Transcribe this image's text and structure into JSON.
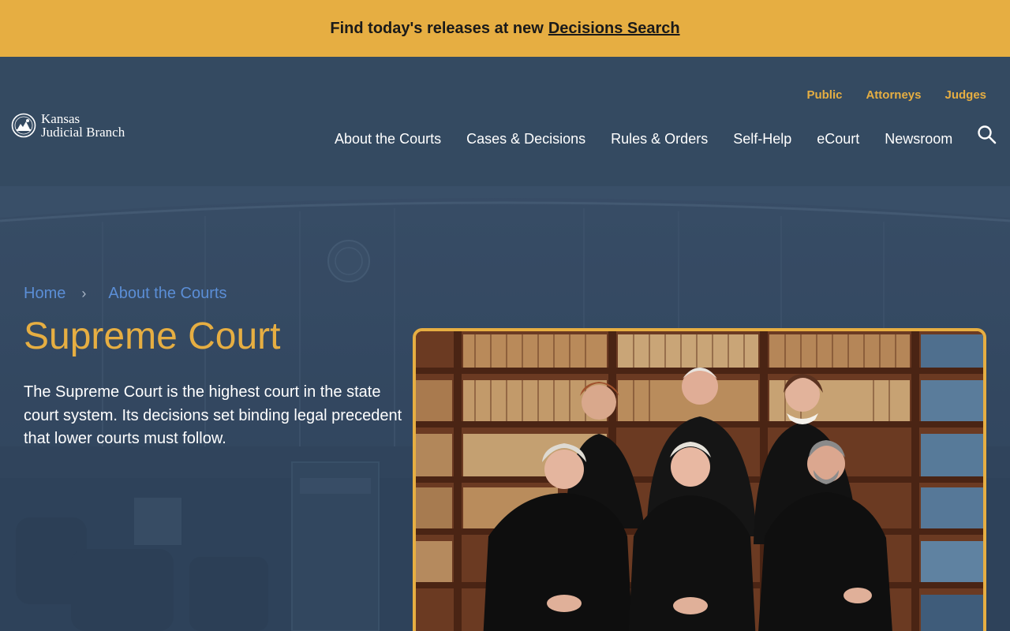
{
  "alert": {
    "text": "Find today's releases at new",
    "link_label": "Decisions Search"
  },
  "logo": {
    "line1": "Kansas",
    "line2": "Judicial Branch"
  },
  "audience_nav": [
    "Public",
    "Attorneys",
    "Judges"
  ],
  "main_nav": [
    "About the Courts",
    "Cases & Decisions",
    "Rules & Orders",
    "Self-Help",
    "eCourt",
    "Newsroom"
  ],
  "breadcrumb": {
    "home": "Home",
    "separator": "›",
    "current": "About the Courts"
  },
  "page": {
    "title": "Supreme Court",
    "intro": "The Supreme Court is the highest court in the state court system. Its decisions set binding legal precedent that lower courts must follow."
  },
  "colors": {
    "alert_bg": "#e6ae42",
    "header_bg": "#344a61",
    "accent_gold": "#e6ae42",
    "link_blue": "#5b8ed6"
  },
  "icons": {
    "search": "search-icon",
    "seal": "kansas-seal-icon"
  }
}
